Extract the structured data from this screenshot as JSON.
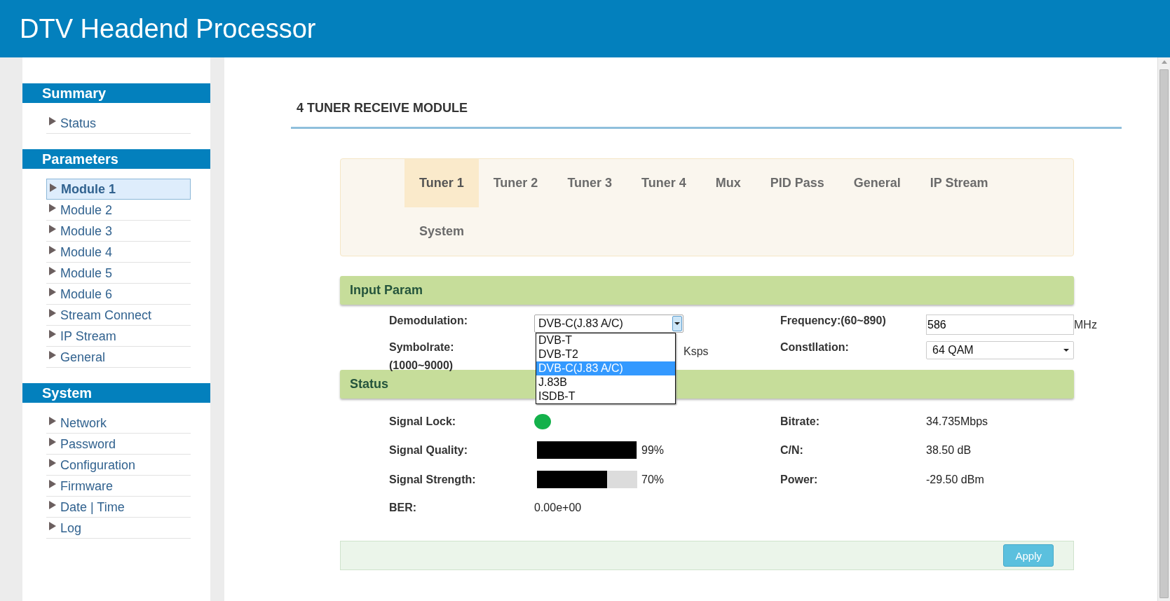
{
  "header": {
    "title": "DTV Headend Processor"
  },
  "sidebar": {
    "sections": [
      {
        "title": "Summary",
        "items": [
          {
            "label": "Status",
            "selected": false
          }
        ]
      },
      {
        "title": "Parameters",
        "items": [
          {
            "label": "Module 1",
            "selected": true
          },
          {
            "label": "Module 2",
            "selected": false
          },
          {
            "label": "Module 3",
            "selected": false
          },
          {
            "label": "Module 4",
            "selected": false
          },
          {
            "label": "Module 5",
            "selected": false
          },
          {
            "label": "Module 6",
            "selected": false
          },
          {
            "label": "Stream Connect",
            "selected": false
          },
          {
            "label": "IP Stream",
            "selected": false
          },
          {
            "label": "General",
            "selected": false
          }
        ]
      },
      {
        "title": "System",
        "items": [
          {
            "label": "Network",
            "selected": false
          },
          {
            "label": "Password",
            "selected": false
          },
          {
            "label": "Configuration",
            "selected": false
          },
          {
            "label": "Firmware",
            "selected": false
          },
          {
            "label": "Date | Time",
            "selected": false
          },
          {
            "label": "Log",
            "selected": false
          }
        ]
      }
    ]
  },
  "page_title": "4 TUNER RECEIVE MODULE",
  "tabs": [
    {
      "label": "Tuner 1",
      "selected": true
    },
    {
      "label": "Tuner 2",
      "selected": false
    },
    {
      "label": "Tuner 3",
      "selected": false
    },
    {
      "label": "Tuner 4",
      "selected": false
    },
    {
      "label": "Mux",
      "selected": false
    },
    {
      "label": "PID Pass",
      "selected": false
    },
    {
      "label": "General",
      "selected": false
    },
    {
      "label": "IP Stream",
      "selected": false
    },
    {
      "label": "System",
      "selected": false
    }
  ],
  "input_param": {
    "title": "Input Param",
    "demodulation": {
      "label": "Demodulation:",
      "value": "DVB-C(J.83 A/C)",
      "expanded": true,
      "options": [
        {
          "label": "DVB-T",
          "selected": false
        },
        {
          "label": "DVB-T2",
          "selected": false
        },
        {
          "label": "DVB-C(J.83 A/C)",
          "selected": true
        },
        {
          "label": "J.83B",
          "selected": false
        },
        {
          "label": "ISDB-T",
          "selected": false
        }
      ]
    },
    "frequency": {
      "label": "Frequency:(60~890)",
      "value": "586",
      "unit": "MHz"
    },
    "symbolrate": {
      "label": "Symbolrate:",
      "range": "(1000~9000)",
      "unit": "Ksps"
    },
    "constellation": {
      "label": "Constllation:",
      "value": "64 QAM"
    }
  },
  "status": {
    "title": "Status",
    "signal_lock": {
      "label": "Signal Lock:",
      "locked": true
    },
    "signal_quality": {
      "label": "Signal Quality:",
      "level": 0.99,
      "reading": "99%"
    },
    "signal_strength": {
      "label": "Signal Strength:",
      "level": 0.7,
      "reading": "70%"
    },
    "ber": {
      "label": "BER:",
      "value": "0.00e+00"
    },
    "bitrate": {
      "label": "Bitrate:",
      "value": "34.735Mbps"
    },
    "cn": {
      "label": "C/N:",
      "value": "38.50 dB"
    },
    "power": {
      "label": "Power:",
      "value": "-29.50 dBm"
    }
  },
  "apply_button": "Apply"
}
